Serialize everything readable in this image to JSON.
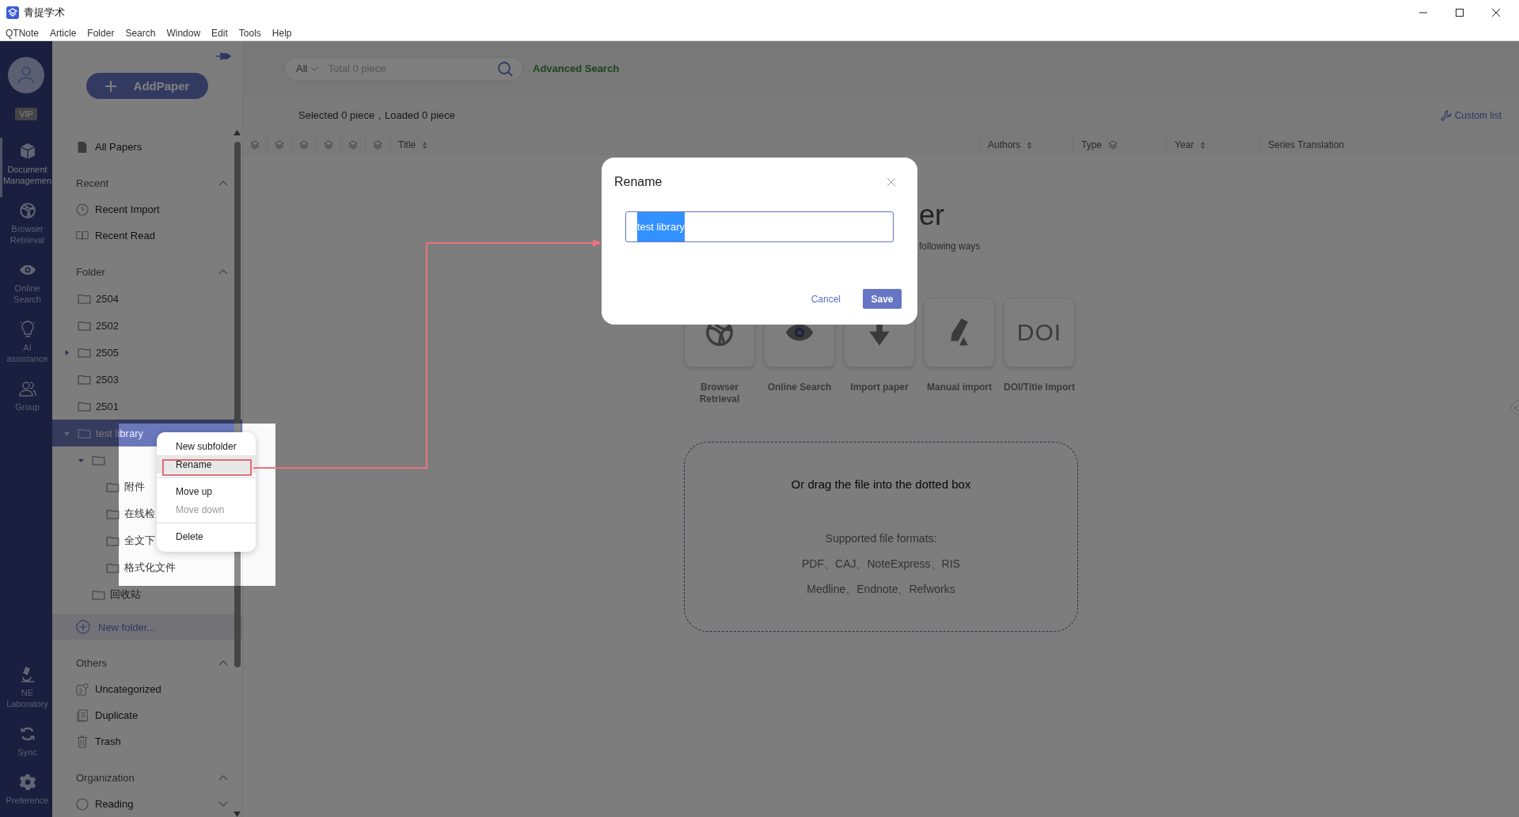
{
  "window": {
    "title": "青提学术"
  },
  "menu_bar": [
    "QTNote",
    "Article",
    "Folder",
    "Search",
    "Window",
    "Edit",
    "Tools",
    "Help"
  ],
  "nav": {
    "vip": "VIP",
    "top": [
      {
        "label": "Document Managemen",
        "kind": "cube",
        "selected": true
      },
      {
        "label": "Browser Retrieval",
        "kind": "ball",
        "selected": false
      },
      {
        "label": "Online Search",
        "kind": "eye",
        "selected": false
      },
      {
        "label": "AI assistance",
        "kind": "bulb",
        "selected": false
      },
      {
        "label": "Group",
        "kind": "people",
        "selected": false
      }
    ],
    "bottom": [
      {
        "label": "NE Laboratory",
        "kind": "microscope",
        "selected": false
      },
      {
        "label": "Sync",
        "kind": "sync",
        "selected": false
      },
      {
        "label": "Preference",
        "kind": "gear",
        "selected": false
      }
    ]
  },
  "sidebar": {
    "add_button": "AddPaper",
    "all_papers": "All Papers",
    "recent": {
      "title": "Recent",
      "expanded": true,
      "items": [
        {
          "label": "Recent Import",
          "kind": "clock"
        },
        {
          "label": "Recent Read",
          "kind": "book"
        }
      ]
    },
    "folders": {
      "title": "Folder",
      "expanded": true,
      "items": [
        {
          "label": "2504",
          "selected": false
        },
        {
          "label": "2502",
          "selected": false
        },
        {
          "label": "2505",
          "selected": false,
          "expanded": false
        },
        {
          "label": "2503",
          "selected": false
        },
        {
          "label": "2501",
          "selected": false
        },
        {
          "label": "test library",
          "selected": true,
          "expanded": true,
          "children": [
            {
              "selected": false,
              "expanded": true,
              "children": [
                {
                  "label": "附件",
                  "selected": false
                },
                {
                  "label": "在线检",
                  "selected": false
                },
                {
                  "label": "全文下",
                  "selected": false
                },
                {
                  "label": "格式化文件",
                  "selected": false
                }
              ]
            },
            {
              "label": "回收站",
              "selected": false
            }
          ]
        }
      ],
      "new_folder": "New folder..."
    },
    "others": {
      "title": "Others",
      "expanded": true,
      "items": [
        {
          "label": "Uncategorized",
          "kind": "uncategorized"
        },
        {
          "label": "Duplicate",
          "kind": "duplicate"
        },
        {
          "label": "Trash",
          "kind": "trash"
        }
      ]
    },
    "organization": {
      "title": "Organization",
      "expanded": true,
      "items": [
        {
          "label": "Reading",
          "kind": "circle",
          "expanded": false
        }
      ]
    }
  },
  "toolbar": {
    "scope": "All",
    "search_placeholder": "Total 0 piece",
    "advanced_search": "Advanced Search"
  },
  "status": "Selected 0 piece，Loaded 0 piece",
  "custom_list": "Custom list",
  "table": {
    "columns": [
      {
        "kind": "layers"
      },
      {
        "kind": "layers"
      },
      {
        "kind": "layers"
      },
      {
        "kind": "layers"
      },
      {
        "kind": "layers"
      },
      {
        "kind": "layers"
      },
      {
        "label": "Title",
        "kind": "sort"
      },
      {
        "label": "Authors",
        "kind": "sort"
      },
      {
        "label": "Type",
        "kind": "layer-sort"
      },
      {
        "label": "Year",
        "kind": "sort"
      },
      {
        "label": "Series Translation",
        "kind": "plain"
      }
    ]
  },
  "empty_state": {
    "heading": "er",
    "subtitle": "following ways",
    "options": [
      {
        "label": "Browser Retrieval",
        "kind": "ball"
      },
      {
        "label": "Online Search",
        "kind": "eye"
      },
      {
        "label": "Import paper",
        "kind": "download"
      },
      {
        "label": "Manual import",
        "kind": "pen"
      },
      {
        "label": "DOI/Title Import",
        "kind": "doi",
        "glyph": "DOI"
      }
    ],
    "drop_title": "Or drag the file into the dotted box",
    "formats_title": "Supported file formats:",
    "formats": [
      "PDF、CAJ、NoteExpress、RIS",
      "Medline、Endnote、Refworks"
    ]
  },
  "context_menu": {
    "groups": [
      [
        {
          "label": "New subfolder",
          "disabled": false,
          "selected": false
        },
        {
          "label": "Rename",
          "disabled": false,
          "selected": true
        }
      ],
      [
        {
          "label": "Move up",
          "disabled": false,
          "selected": false
        },
        {
          "label": "Move down",
          "disabled": true,
          "selected": false
        }
      ],
      [
        {
          "label": "Delete",
          "disabled": false,
          "selected": false
        }
      ]
    ]
  },
  "dialog": {
    "title": "Rename",
    "value": "test library",
    "text_selected": true,
    "buttons": [
      {
        "label": "Cancel",
        "kind": "link"
      },
      {
        "label": "Save",
        "kind": "primary"
      }
    ]
  }
}
